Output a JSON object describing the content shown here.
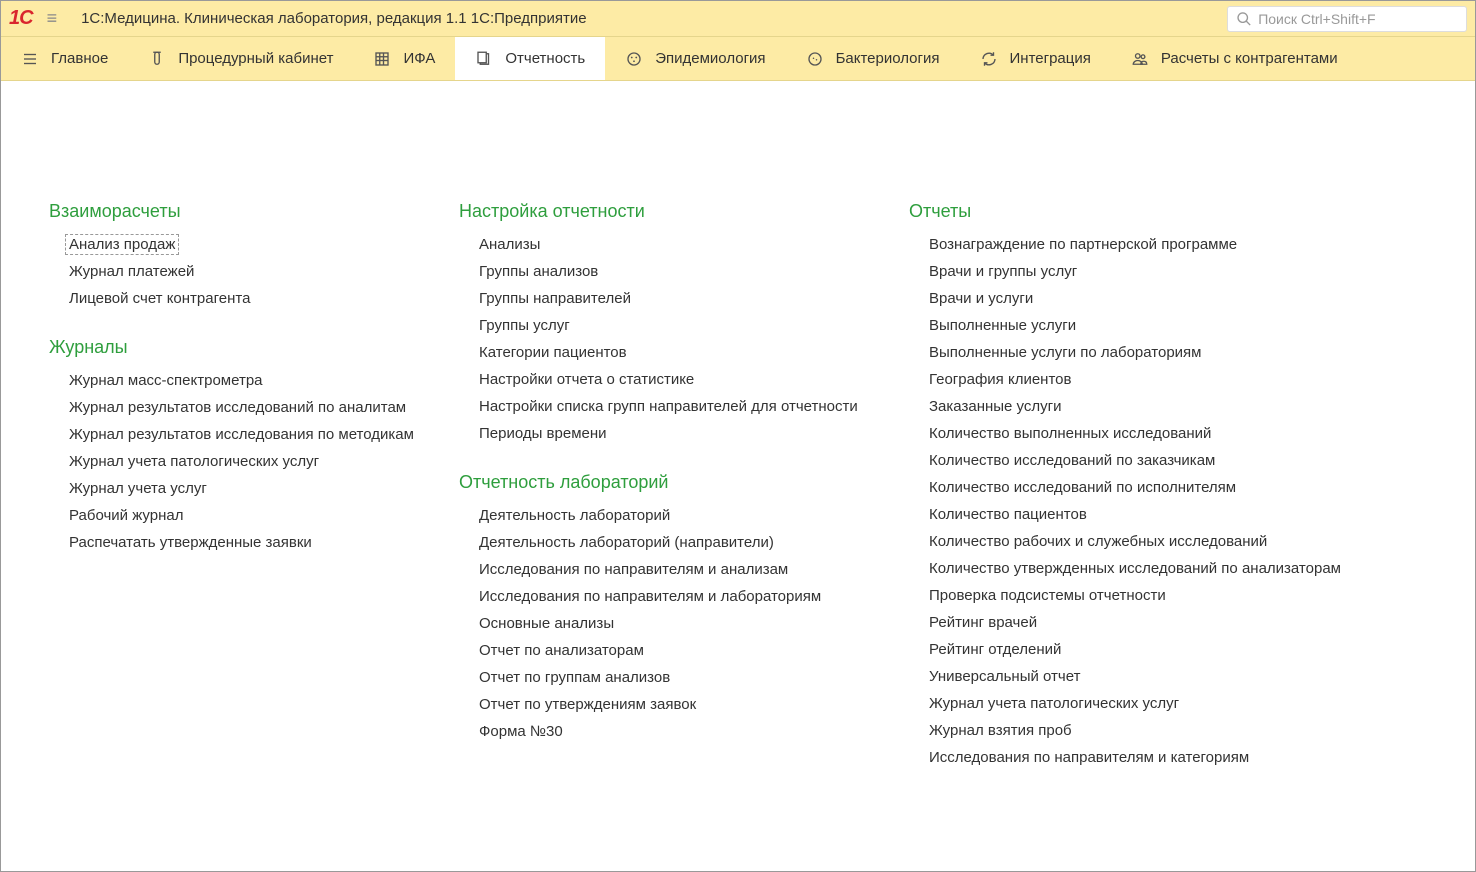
{
  "app": {
    "title": "1С:Медицина. Клиническая лаборатория, редакция 1.1 1С:Предприятие",
    "logo_text": "1C"
  },
  "search": {
    "placeholder": "Поиск Ctrl+Shift+F"
  },
  "nav": [
    {
      "label": "Главное",
      "icon": "menu"
    },
    {
      "label": "Процедурный кабинет",
      "icon": "tube"
    },
    {
      "label": "ИФА",
      "icon": "grid"
    },
    {
      "label": "Отчетность",
      "icon": "docs",
      "active": true
    },
    {
      "label": "Эпидемиология",
      "icon": "virus"
    },
    {
      "label": "Бактериология",
      "icon": "bacteria"
    },
    {
      "label": "Интеграция",
      "icon": "refresh"
    },
    {
      "label": "Расчеты с контрагентами",
      "icon": "people"
    }
  ],
  "sections": {
    "col1": [
      {
        "title": "Взаиморасчеты",
        "items": [
          "Анализ продаж",
          "Журнал платежей",
          "Лицевой счет контрагента"
        ]
      },
      {
        "title": "Журналы",
        "items": [
          "Журнал масс-спектрометра",
          "Журнал результатов исследований по аналитам",
          "Журнал результатов исследования по методикам",
          "Журнал учета патологических услуг",
          "Журнал учета услуг",
          "Рабочий журнал",
          "Распечатать утвержденные заявки"
        ]
      }
    ],
    "col2": [
      {
        "title": "Настройка отчетности",
        "items": [
          "Анализы",
          "Группы анализов",
          "Группы направителей",
          "Группы услуг",
          "Категории пациентов",
          "Настройки отчета о статистике",
          "Настройки списка групп направителей для отчетности",
          "Периоды времени"
        ]
      },
      {
        "title": "Отчетность лабораторий",
        "items": [
          "Деятельность лабораторий",
          "Деятельность лабораторий (направители)",
          "Исследования по направителям и анализам",
          "Исследования по направителям и лабораториям",
          "Основные анализы",
          "Отчет по анализаторам",
          "Отчет по группам анализов",
          "Отчет по утверждениям заявок",
          "Форма №30"
        ]
      }
    ],
    "col3": [
      {
        "title": "Отчеты",
        "items": [
          "Вознаграждение по партнерской программе",
          "Врачи и группы услуг",
          "Врачи и услуги",
          "Выполненные услуги",
          "Выполненные услуги по лабораториям",
          "География клиентов",
          "Заказанные услуги",
          "Количество выполненных исследований",
          "Количество исследований по заказчикам",
          "Количество исследований по исполнителям",
          "Количество пациентов",
          "Количество рабочих и служебных исследований",
          "Количество утвержденных исследований по анализаторам",
          "Проверка подсистемы отчетности",
          "Рейтинг врачей",
          "Рейтинг отделений",
          "Универсальный отчет",
          "Журнал учета патологических услуг",
          "Журнал взятия проб",
          "Исследования по направителям и категориям"
        ]
      }
    ]
  },
  "focused_item": "Анализ продаж"
}
